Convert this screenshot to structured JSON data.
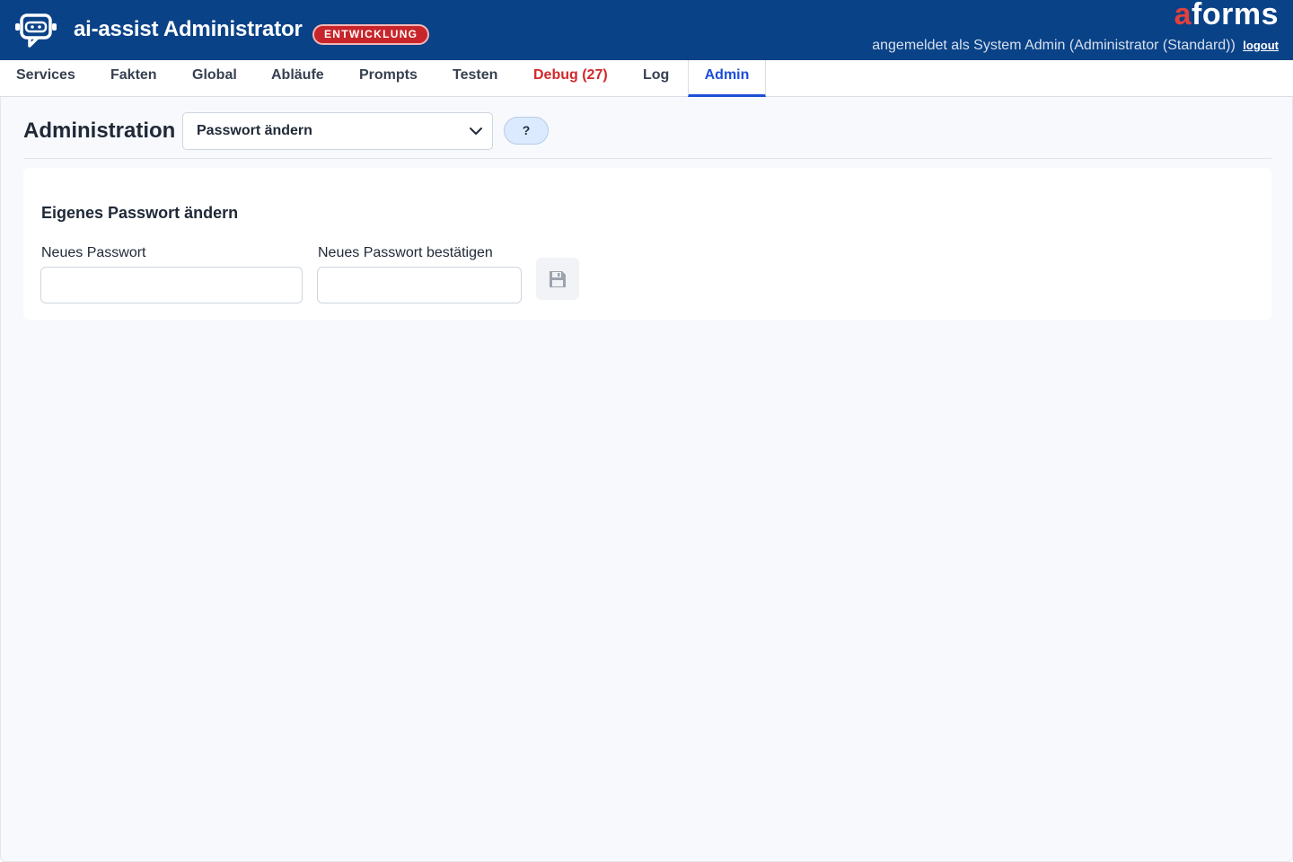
{
  "header": {
    "title": "ai-assist Administrator",
    "env_badge": "ENTWICKLUNG",
    "brand_accent": "a",
    "brand_rest": "forms",
    "user_text": "angemeldet als System Admin (Administrator (Standard))",
    "logout_label": "logout",
    "logo_icon": "chat-bot-icon"
  },
  "tabs": [
    {
      "label": "Services"
    },
    {
      "label": "Fakten"
    },
    {
      "label": "Global"
    },
    {
      "label": "Abläufe"
    },
    {
      "label": "Prompts"
    },
    {
      "label": "Testen"
    },
    {
      "label": "Debug (27)"
    },
    {
      "label": "Log"
    },
    {
      "label": "Admin",
      "active": true
    }
  ],
  "main": {
    "title": "Administration",
    "select_value": "Passwort ändern",
    "help_label": "?"
  },
  "card": {
    "title": "Eigenes Passwort ändern",
    "new_password_label": "Neues Passwort",
    "new_password_value": "",
    "confirm_password_label": "Neues Passwort bestätigen",
    "confirm_password_value": "",
    "save_icon": "floppy-disk-icon"
  },
  "colors": {
    "header_bg": "#0a4287",
    "badge_bg": "#c8252a",
    "active_tab": "#1d4ed8",
    "debug_tab": "#d1282b",
    "brand_accent": "#e4403b"
  }
}
